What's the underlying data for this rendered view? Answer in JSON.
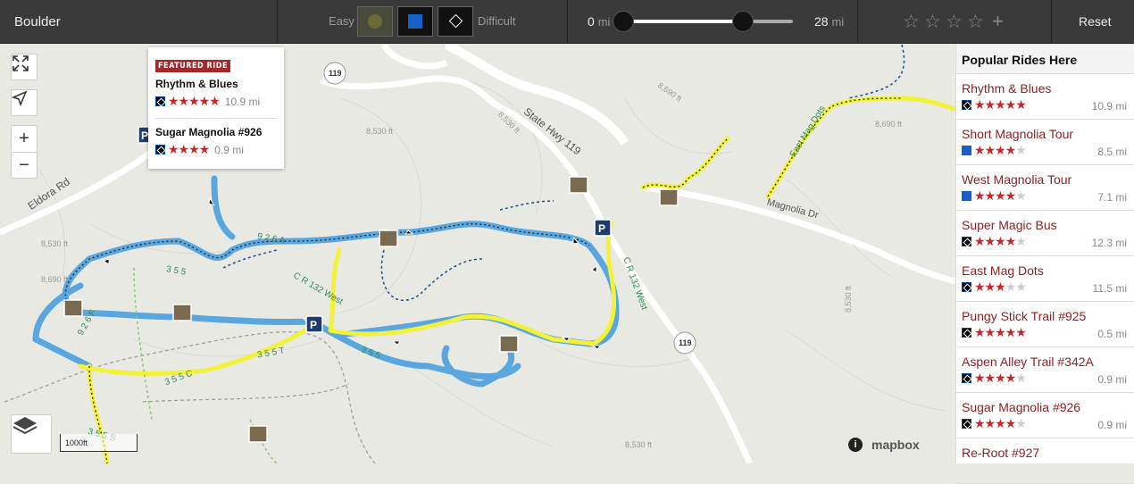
{
  "topbar": {
    "location": "Boulder",
    "easy_label": "Easy",
    "difficult_label": "Difficult",
    "dist_min": "0",
    "dist_max": "28",
    "dist_unit": "mi",
    "reset_label": "Reset",
    "max_fraction": 0.71
  },
  "map": {
    "scale_label": "1000ft",
    "attribution": "mapbox",
    "labels": {
      "hwy119": "State Hwy 119",
      "magnolia": "Magnolia Dr",
      "eldora": "Eldora Rd",
      "eastmag": "East Mag Dots",
      "cr132": "C R 132 West",
      "cr132b": "C R 132 West",
      "t926a": "9 2 6 A",
      "t355": "3 5 5",
      "t355t": "3 5 5 T",
      "t355c": "3 5 5 C",
      "t355b": "3 5 5",
      "t355s": "3 5 5 S",
      "t926f": "9 2 6 F",
      "e1": "8,530 ft",
      "e2": "8,530 ft",
      "e3": "8,690 ft",
      "e4": "8,530 ft",
      "e5": "8,690 ft",
      "e6": "8,690 ft",
      "e7": "8,530 ft",
      "e8": "8,530 ft",
      "shield": "119"
    }
  },
  "popup": {
    "badge": "FEATURED RIDE",
    "rides": [
      {
        "name": "Rhythm & Blues",
        "stars": "★★★★★",
        "mi": "10.9 mi"
      },
      {
        "name": "Sugar Magnolia #926",
        "stars": "★★★★",
        "mi": "0.9 mi"
      }
    ]
  },
  "sidebar": {
    "title": "Popular Rides Here",
    "rides": [
      {
        "name": "Rhythm & Blues",
        "mi": "10.9 mi",
        "rating": 4.5,
        "diff": "diamond"
      },
      {
        "name": "Short Magnolia Tour",
        "mi": "8.5 mi",
        "rating": 4,
        "diff": "square"
      },
      {
        "name": "West Magnolia Tour",
        "mi": "7.1 mi",
        "rating": 3.5,
        "diff": "square"
      },
      {
        "name": "Super Magic Bus",
        "mi": "12.3 mi",
        "rating": 3.5,
        "diff": "diamond"
      },
      {
        "name": "East Mag Dots",
        "mi": "11.5 mi",
        "rating": 2.5,
        "diff": "diamond"
      },
      {
        "name": "Pungy Stick Trail #925",
        "mi": "0.5 mi",
        "rating": 4.5,
        "diff": "diamond"
      },
      {
        "name": "Aspen Alley Trail #342A",
        "mi": "0.9 mi",
        "rating": 4,
        "diff": "diamond"
      },
      {
        "name": "Sugar Magnolia #926",
        "mi": "0.9 mi",
        "rating": 4,
        "diff": "diamond"
      },
      {
        "name": "Re-Root #927",
        "mi": "",
        "rating": 0,
        "diff": "diamond"
      }
    ]
  },
  "colors": {
    "topbar": "#3a3a3a",
    "accent": "#c3282d",
    "ride_name": "#8c1f1f",
    "trail_blue": "#5aa7e0",
    "trail_yellow": "#f2f23a",
    "easy": "#6b6b3a",
    "intermediate": "#1760c9"
  }
}
